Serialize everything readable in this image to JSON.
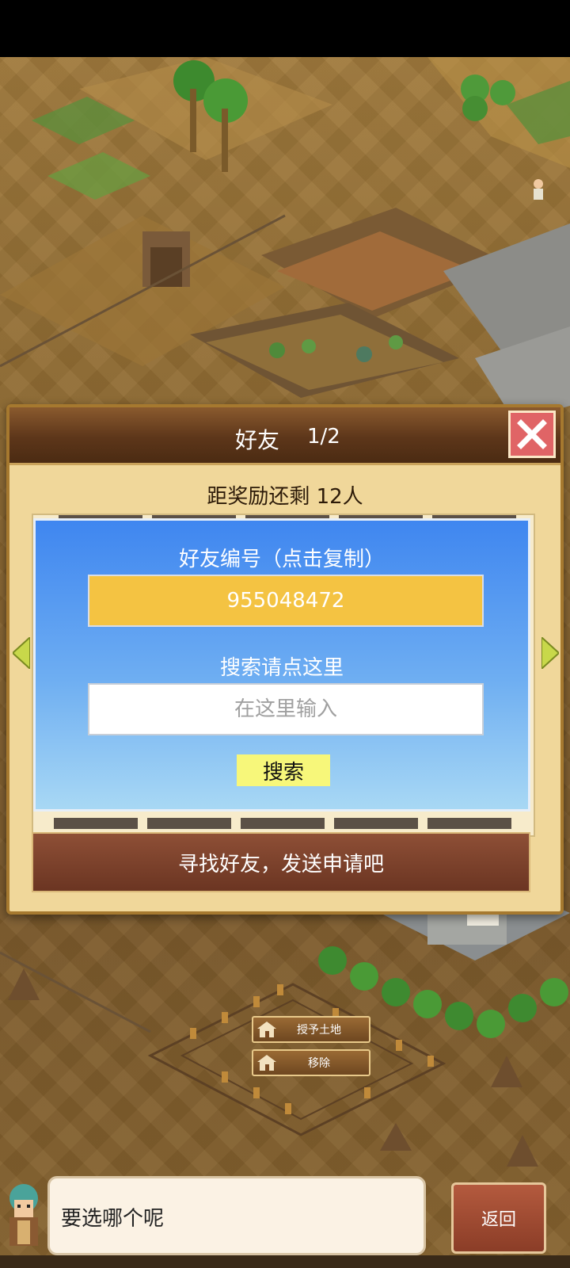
{
  "dialog": {
    "title": "好友",
    "page": "1/2",
    "close_icon": "close-x-icon",
    "reward_text": "距奖励还剩 12人",
    "friend_id_label": "好友编号（点击复制）",
    "friend_id": "955048472",
    "search_label": "搜索请点这里",
    "search_placeholder": "在这里输入",
    "search_button": "搜索",
    "find_banner": "寻找好友，发送申请吧"
  },
  "map_buttons": {
    "grant_land": "授予土地",
    "remove": "移除"
  },
  "bottom": {
    "speech": "要选哪个呢",
    "back": "返回"
  },
  "colors": {
    "panel_blue": "#3f86f0",
    "id_yellow": "#f4c342",
    "close_red": "#e06466",
    "search_btn": "#f7f77a"
  }
}
